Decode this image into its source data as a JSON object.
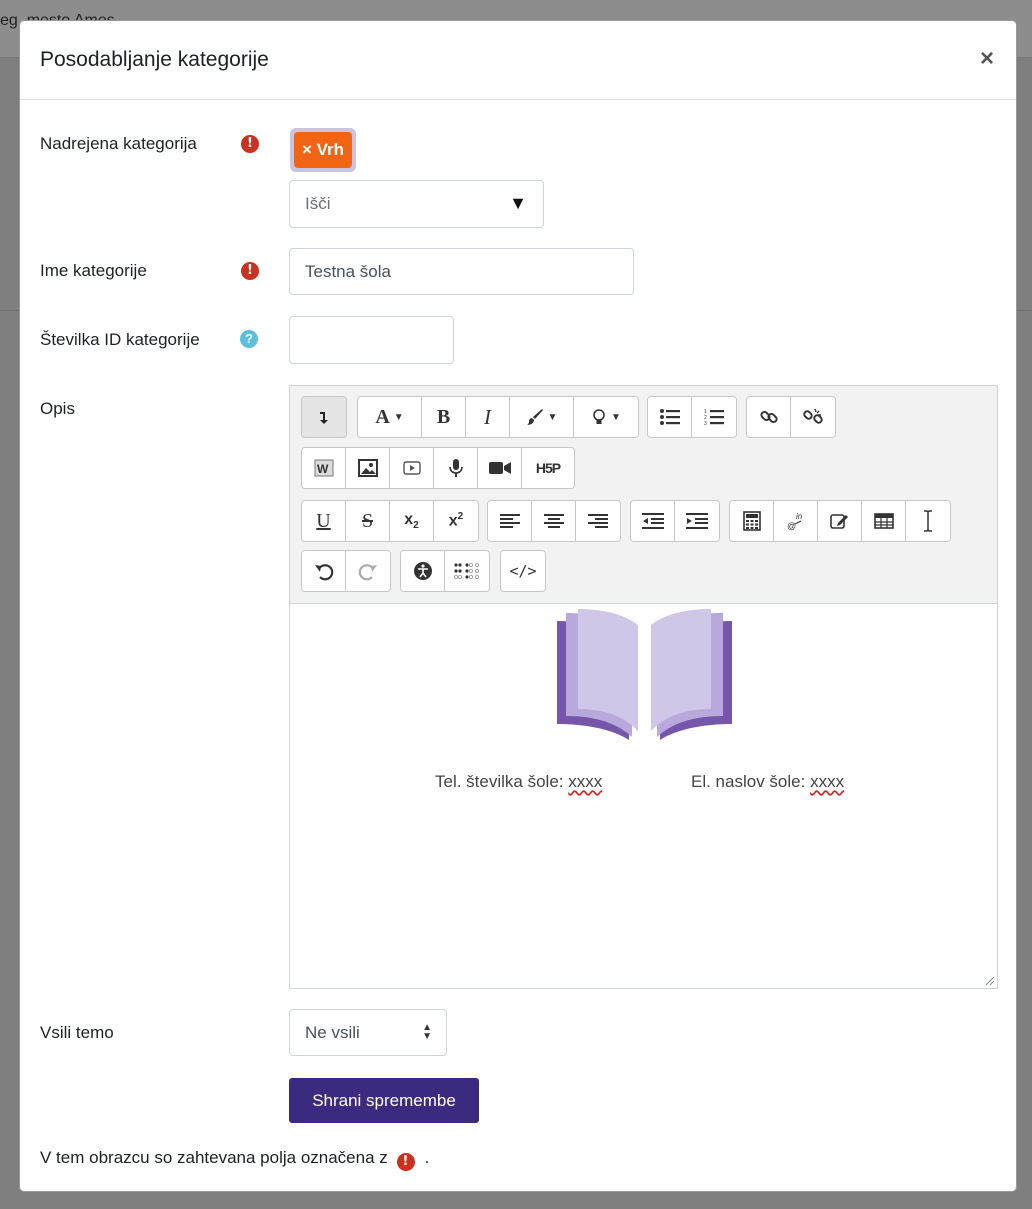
{
  "background": {
    "text": "eg. mesto   Ames"
  },
  "modal": {
    "title": "Posodabljanje kategorije",
    "close_label": "×"
  },
  "form": {
    "parent_category": {
      "label": "Nadrejena kategorija",
      "selected_tag": "× Vrh",
      "search_placeholder": "Išči",
      "required": true
    },
    "category_name": {
      "label": "Ime kategorije",
      "value": "Testna šola",
      "required": true
    },
    "category_id": {
      "label": "Številka ID kategorije",
      "value": "",
      "help": true
    },
    "description": {
      "label": "Opis",
      "content": {
        "phone_label": "Tel. številka šole: ",
        "phone_value": "xxxx",
        "email_label": "El. naslov šole: ",
        "email_value": "xxxx",
        "image_icon": "open-book-icon"
      }
    },
    "force_theme": {
      "label": "Vsili temo",
      "selected": "Ne vsili"
    },
    "submit_label": "Shrani spremembe",
    "required_note": "V tem obrazcu so zahtevana polja označena z",
    "required_note_suffix": "."
  },
  "toolbar": {
    "bold_glyph": "B",
    "italic_glyph": "I",
    "font_glyph": "A",
    "underline_glyph": "U",
    "strike_glyph": "S",
    "subscript_glyph": "x",
    "subscript_sub": "2",
    "superscript_glyph": "x",
    "superscript_sup": "2",
    "h5p_label": "H5P",
    "code_glyph": "</>"
  },
  "colors": {
    "tag_bg": "#f06414",
    "tag_focus": "#c9c4df",
    "required": "#ca3120",
    "help": "#5bc0de",
    "primary_button": "#3b2a7f",
    "book_light": "#d0c6e8",
    "book_dark": "#7556ab"
  }
}
